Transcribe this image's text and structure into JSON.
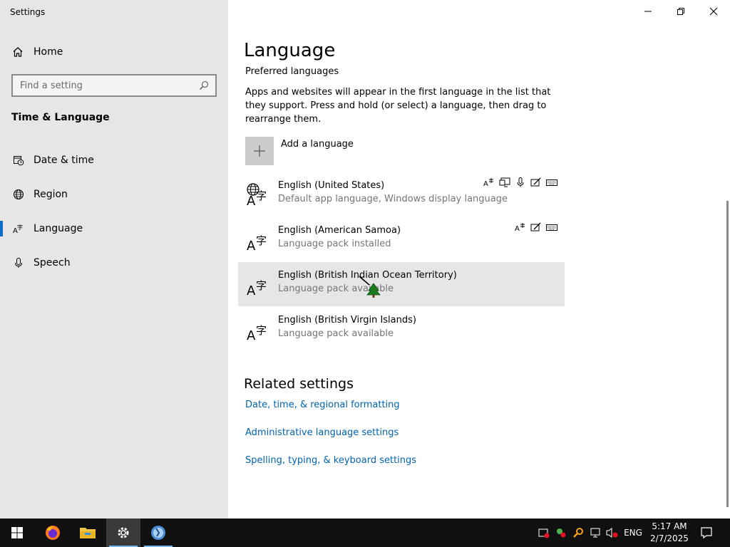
{
  "window": {
    "title": "Settings",
    "controls": {
      "minimize": "minimize-icon",
      "restore": "restore-icon",
      "close": "close-icon"
    }
  },
  "sidebar": {
    "home_label": "Home",
    "search_placeholder": "Find a setting",
    "section_heading": "Time & Language",
    "items": [
      {
        "label": "Date & time",
        "icon": "calendar-clock-icon",
        "active": false
      },
      {
        "label": "Region",
        "icon": "globe-icon",
        "active": false
      },
      {
        "label": "Language",
        "icon": "language-icon",
        "active": true
      },
      {
        "label": "Speech",
        "icon": "microphone-icon",
        "active": false
      }
    ]
  },
  "main": {
    "title": "Language",
    "subtitle": "Preferred languages",
    "description": "Apps and websites will appear in the first language in the list that they support. Press and hold (or select) a language, then drag to rearrange them.",
    "add_language_label": "Add a language",
    "languages": [
      {
        "name": "English (United States)",
        "status": "Default app language, Windows display language",
        "features": [
          "text-to-speech-icon",
          "display-language-icon",
          "speech-recognition-icon",
          "handwriting-icon",
          "keyboard-icon"
        ]
      },
      {
        "name": "English (American Samoa)",
        "status": "Language pack installed",
        "features": [
          "text-to-speech-icon",
          "handwriting-icon",
          "keyboard-icon"
        ]
      },
      {
        "name": "English (British Indian Ocean Territory)",
        "status": "Language pack available",
        "features": []
      },
      {
        "name": "English (British Virgin Islands)",
        "status": "Language pack available",
        "features": []
      }
    ],
    "related_heading": "Related settings",
    "related_links": [
      "Date, time, & regional formatting",
      "Administrative language settings",
      "Spelling, typing, & keyboard settings"
    ]
  },
  "taskbar": {
    "apps": [
      "windows-start-icon",
      "firefox-icon",
      "file-explorer-icon",
      "settings-icon",
      "network-globe-icon"
    ],
    "active_app": "settings-icon",
    "tray_icons": [
      "action-center-flag-icon",
      "network-error-icon",
      "search-key-icon",
      "network-icon",
      "volume-muted-icon"
    ],
    "input_language": "ENG",
    "time": "5:17 AM",
    "date": "2/7/2025",
    "notifications_icon": "notifications-icon"
  },
  "colors": {
    "sidebar_bg": "#e6e6e6",
    "accent": "#0a6cc4",
    "link": "#0063b1",
    "taskbar_bg": "#101010"
  }
}
